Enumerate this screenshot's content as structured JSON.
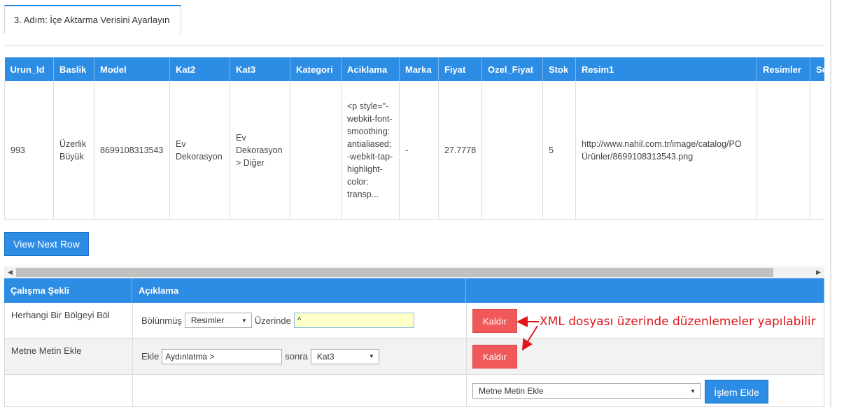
{
  "step_tab": {
    "label": "3. Adım: İçe Aktarma Verisini Ayarlayın"
  },
  "preview": {
    "headers": [
      "Urun_Id",
      "Baslik",
      "Model",
      "Kat2",
      "Kat3",
      "Kategori",
      "Aciklama",
      "Marka",
      "Fiyat",
      "Ozel_Fiyat",
      "Stok",
      "Resim1",
      "Resimler",
      "Se"
    ],
    "row": {
      "urun_id": "993",
      "baslik": "Üzerlik Büyük",
      "model": "8699108313543",
      "kat2": "Ev Dekorasyon",
      "kat3": "Ev Dekorasyon > Diğer",
      "kategori": "",
      "aciklama": "<p style=\"-webkit-font-smoothing: antialiased; -webkit-tap-highlight-color: transp...",
      "marka": "-",
      "fiyat": "27.7778",
      "ozel_fiyat": "",
      "stok": "5",
      "resim1": "http://www.nahil.com.tr/image/catalog/PO Ürünler/8699108313543.png",
      "resimler": "",
      "se": ""
    }
  },
  "buttons": {
    "view_next_row": "View Next Row",
    "remove": "Kaldır",
    "add_operation": "İşlem Ekle"
  },
  "rules": {
    "headers": [
      "Çalışma Şekli",
      "Açıklama",
      ""
    ],
    "rows": [
      {
        "mode": "Herhangi Bir Bölgeyi Böl",
        "prefix": "Bölünmüş",
        "select_value": "Resimler",
        "mid_label": "Üzerinde",
        "input_value": "^"
      },
      {
        "mode": "Metne Metin Ekle",
        "prefix": "Ekle",
        "input_value": "Aydınlatma >",
        "mid_label": "sonra",
        "select_value": "Kat3"
      }
    ],
    "add_select_value": "Metne Metin Ekle"
  },
  "annotation": {
    "text": "XML dosyası üzerinde düzenlemeler yapılabilir",
    "color": "#e0151b"
  },
  "colors": {
    "accent": "#2d8ce3",
    "danger": "#f0585a"
  }
}
